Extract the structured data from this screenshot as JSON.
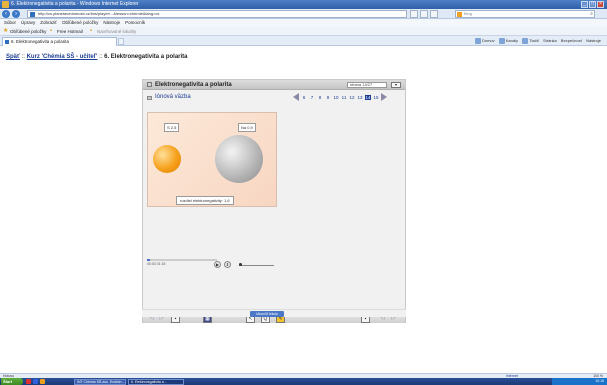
{
  "browser": {
    "title": "6. Elektronegativita a polarita - Windows Internet Explorer",
    "url": "http://cs.planetavedomosti.cz/lms/player/...&lesson=chemie&lang=cs",
    "search_placeholder": "Bing",
    "menu": [
      "Súbor",
      "Úpravy",
      "Zobraziť",
      "Obľúbené položky",
      "Nástroje",
      "Pomocník"
    ],
    "favorites": [
      {
        "label": "Obľúbené položky"
      },
      {
        "label": "Free Hotmail"
      },
      {
        "label": "Navrhované lokality"
      }
    ],
    "tab_label": "6. Elektronegativita a polarita",
    "command_items": [
      "Domov",
      "Kanály",
      "Tlačiť",
      "Stránka",
      "Bezpečnosť",
      "Nástroje"
    ]
  },
  "page": {
    "crumb_back": "Späť",
    "crumb_course": "Kurz 'Chémia SŠ - učiteľ'",
    "crumb_current": "6. Elektronegativita a polarita",
    "crumb_sep1": " :: ",
    "crumb_sep2": " :: "
  },
  "lesson": {
    "title": "Elektronegativita a polarita",
    "slide_select": "strana 14/27",
    "subtitle": "Iónová väzba",
    "pages": [
      "6",
      "7",
      "8",
      "9",
      "10",
      "11",
      "12",
      "13",
      "14",
      "15"
    ],
    "active_page": "14",
    "label_s": "S 2,5",
    "label_na": "Na 0,9",
    "difference": "rozdiel elektronegativity: 1,6",
    "time": "00:03   01:15",
    "progress_fraction": 0.04,
    "volume_fraction": 0.0
  },
  "bottom_button": "Ukončiť lekciu",
  "status": {
    "left": "Hotovo",
    "zone": "Internet",
    "zoom": "100 %"
  },
  "taskbar": {
    "start": "Štart",
    "tasks": [
      {
        "label": "INT Chémia SŠ-doc. Endlich...",
        "active": false
      },
      {
        "label": "6. Elektronegativita a...",
        "active": true
      }
    ],
    "clock": "10:15"
  },
  "colors": {
    "titlebar": "#2f5fa8",
    "link": "#1a3c96",
    "sim_bg": "#fde9d9",
    "sulfur_ball": "#f6a01a",
    "sodium_ball": "#b8b8b8"
  }
}
